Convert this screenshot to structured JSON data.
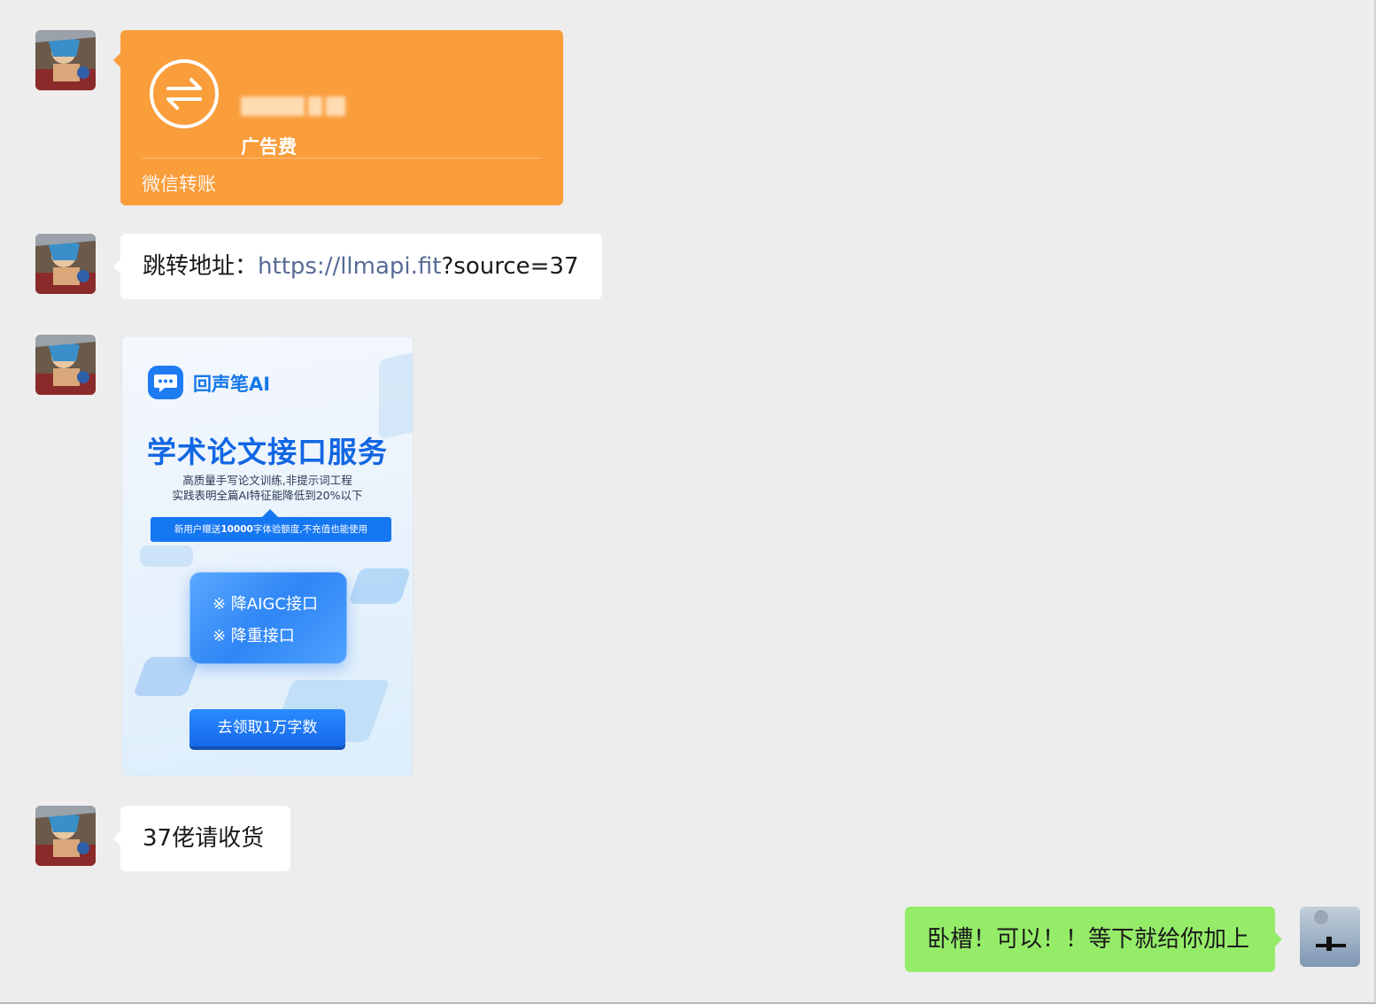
{
  "theme": {
    "background": "#ededed",
    "transfer_orange": "#fa9d3b",
    "bubble_other": "#ffffff",
    "bubble_self": "#95ec69",
    "link_color": "#576b95"
  },
  "messages": [
    {
      "type": "transfer",
      "sender": "other",
      "note": "广告费",
      "footer": "微信转账",
      "icon": "transfer-arrows-icon"
    },
    {
      "type": "text",
      "sender": "other",
      "prefix": "跳转地址：",
      "link": "https://llmapi.fit",
      "suffix": "?source=37"
    },
    {
      "type": "image",
      "sender": "other",
      "ad": {
        "brand": "回声笔AI",
        "title": "学术论文接口服务",
        "sub1": "高质量手写论文训练,非提示词工程",
        "sub2": "实践表明全篇AI特征能降低到20%以下",
        "banner_pre": "新用户赠送",
        "banner_num": "10000",
        "banner_post": "字体验额度,不充值也能使用",
        "item1": "※ 降AIGC接口",
        "item2": "※ 降重接口",
        "cta": "去领取1万字数"
      }
    },
    {
      "type": "text",
      "sender": "other",
      "text": "37佬请收货"
    },
    {
      "type": "text",
      "sender": "self",
      "text": "卧槽！可以！！等下就给你加上"
    }
  ]
}
